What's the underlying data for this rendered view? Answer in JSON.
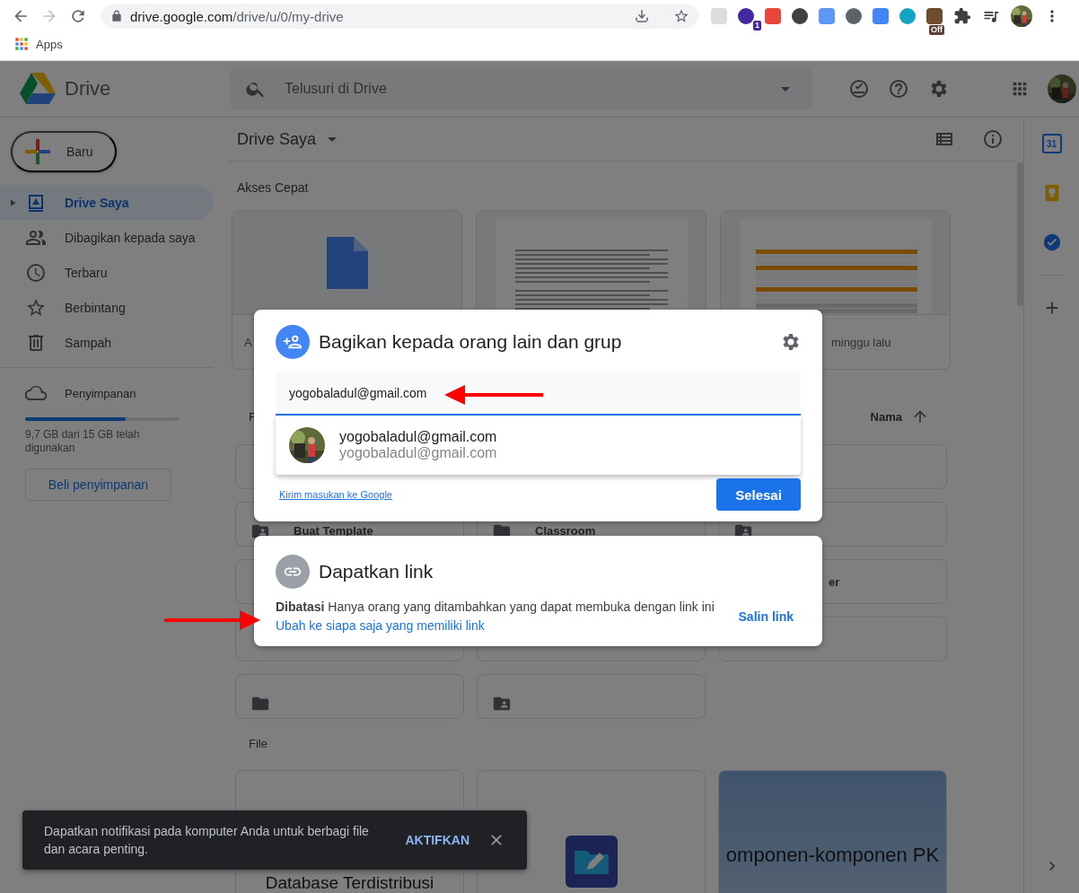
{
  "browser": {
    "url_host": "drive.google.com",
    "url_path": "/drive/u/0/my-drive",
    "extensions": [
      {
        "color": "#dadce0"
      },
      {
        "color": "#4527a0",
        "badge": "1"
      },
      {
        "color": "#e8453c"
      },
      {
        "color": "#3c4043"
      },
      {
        "color": "#5e97f6"
      },
      {
        "color": "#5f6368"
      },
      {
        "color": "#4285f4"
      },
      {
        "color": "#12a4c4"
      },
      {
        "color": "#6d4c2f",
        "badge": "Off"
      }
    ],
    "bookmarks": [
      {
        "label": "Apps"
      }
    ]
  },
  "header": {
    "product": "Drive",
    "search": {
      "placeholder": "Telusuri di Drive"
    }
  },
  "sidebar": {
    "new_button": "Baru",
    "items": [
      {
        "label": "Drive Saya",
        "selected": true,
        "expandable": true
      },
      {
        "label": "Dibagikan kepada saya",
        "selected": false,
        "expandable": false
      },
      {
        "label": "Terbaru",
        "selected": false,
        "expandable": false
      },
      {
        "label": "Berbintang",
        "selected": false,
        "expandable": false
      },
      {
        "label": "Sampah",
        "selected": false,
        "expandable": false
      }
    ],
    "storage": {
      "label": "Penyimpanan",
      "level": 0.65,
      "usage": "9,7 GB dari 15 GB telah digunakan",
      "buy_button": "Beli penyimpanan"
    }
  },
  "main": {
    "title": "Drive Saya",
    "quick_access": {
      "heading": "Akses Cepat",
      "cards": [
        {
          "kind": "doc",
          "caption": "A"
        },
        {
          "kind": "text-page"
        },
        {
          "kind": "sheet-page",
          "caption": "minggu lalu"
        }
      ]
    },
    "folders": {
      "heading": "F",
      "sort": "Nama",
      "cards": [
        {
          "kind": "blank"
        },
        {
          "kind": "blank"
        },
        {
          "kind": "shared",
          "label": "Buat Template"
        },
        {
          "kind": "folder",
          "label": "Classroom"
        },
        {
          "kind": "shared"
        },
        {
          "kind": "blank"
        },
        {
          "kind": "tail",
          "label": "er"
        },
        {
          "kind": "blank"
        },
        {
          "kind": "blank"
        },
        {
          "kind": "blank"
        },
        {
          "kind": "folder"
        },
        {
          "kind": "shared"
        }
      ]
    },
    "files": {
      "heading": "File",
      "cards": [
        {
          "kind": "doc-title",
          "title": "Database Terdistribusi"
        },
        {
          "kind": "app"
        },
        {
          "kind": "slide",
          "title": "omponen-komponen PK"
        }
      ]
    }
  },
  "side_panel": {
    "calendar_day": "31"
  },
  "share_dialog": {
    "title": "Bagikan kepada orang lain dan grup",
    "input": {
      "value": "yogobaladul@gmail.com"
    },
    "suggestion": {
      "name": "yogobaladul@gmail.com",
      "email": "yogobaladul@gmail.com"
    },
    "feedback_link": "Kirim masukan ke Google",
    "done_button": "Selesai"
  },
  "link_panel": {
    "title": "Dapatkan link",
    "access_text": "**Dibatasi** Hanya orang yang ditambahkan yang dapat membuka dengan link ini",
    "change_link": "Ubah ke siapa saja yang memiliki link",
    "copy_link": "Salin link"
  },
  "snackbar": {
    "message": "Dapatkan notifikasi pada komputer Anda untuk berbagi file dan acara penting.",
    "action": "AKTIFKAN"
  }
}
